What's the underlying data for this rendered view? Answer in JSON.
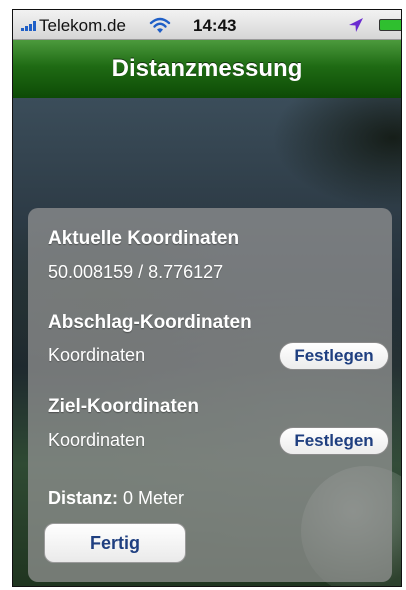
{
  "status_bar": {
    "carrier": "Telekom.de",
    "time": "14:43",
    "icons": [
      "signal-icon",
      "wifi-icon",
      "location-arrow-icon",
      "battery-icon"
    ]
  },
  "nav": {
    "title": "Distanzmessung",
    "color": "#1f6b14"
  },
  "current": {
    "heading": "Aktuelle Koordinaten",
    "value": "50.008159 / 8.776127"
  },
  "tee": {
    "heading": "Abschlag-Koordinaten",
    "value": "Koordinaten",
    "button": "Festlegen"
  },
  "target": {
    "heading": "Ziel-Koordinaten",
    "value": "Koordinaten",
    "button": "Festlegen"
  },
  "distance": {
    "label": "Distanz:",
    "value": "0 Meter"
  },
  "done_button": "Fertig",
  "colors": {
    "button_text": "#1f3f80",
    "panel": "#969696"
  }
}
